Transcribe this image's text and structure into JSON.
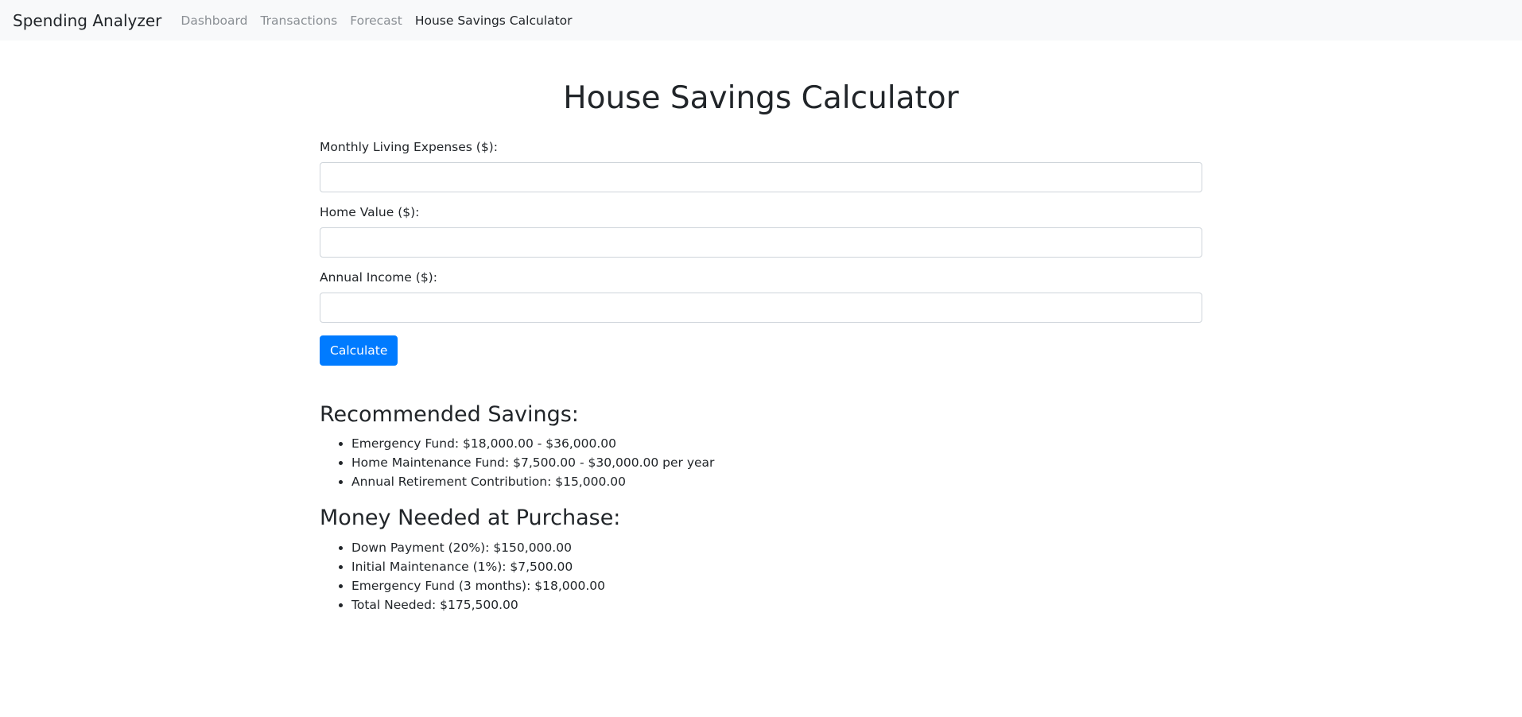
{
  "navbar": {
    "brand": "Spending Analyzer",
    "links": [
      {
        "label": "Dashboard",
        "active": false
      },
      {
        "label": "Transactions",
        "active": false
      },
      {
        "label": "Forecast",
        "active": false
      },
      {
        "label": "House Savings Calculator",
        "active": true
      }
    ]
  },
  "page": {
    "title": "House Savings Calculator"
  },
  "form": {
    "monthly_expenses": {
      "label": "Monthly Living Expenses ($):",
      "value": "",
      "placeholder": ""
    },
    "home_value": {
      "label": "Home Value ($):",
      "value": "",
      "placeholder": ""
    },
    "annual_income": {
      "label": "Annual Income ($):",
      "value": "",
      "placeholder": ""
    },
    "calculate_label": "Calculate"
  },
  "results": {
    "recommended": {
      "heading": "Recommended Savings:",
      "items": [
        "Emergency Fund: $18,000.00 - $36,000.00",
        "Home Maintenance Fund: $7,500.00 - $30,000.00 per year",
        "Annual Retirement Contribution: $15,000.00"
      ]
    },
    "purchase": {
      "heading": "Money Needed at Purchase:",
      "items": [
        "Down Payment (20%): $150,000.00",
        "Initial Maintenance (1%): $7,500.00",
        "Emergency Fund (3 months): $18,000.00",
        "Total Needed: $175,500.00"
      ]
    }
  },
  "colors": {
    "primary": "#007bff",
    "navbar_bg": "#f8f9fa",
    "text": "#212529",
    "muted": "#8a8f94"
  }
}
